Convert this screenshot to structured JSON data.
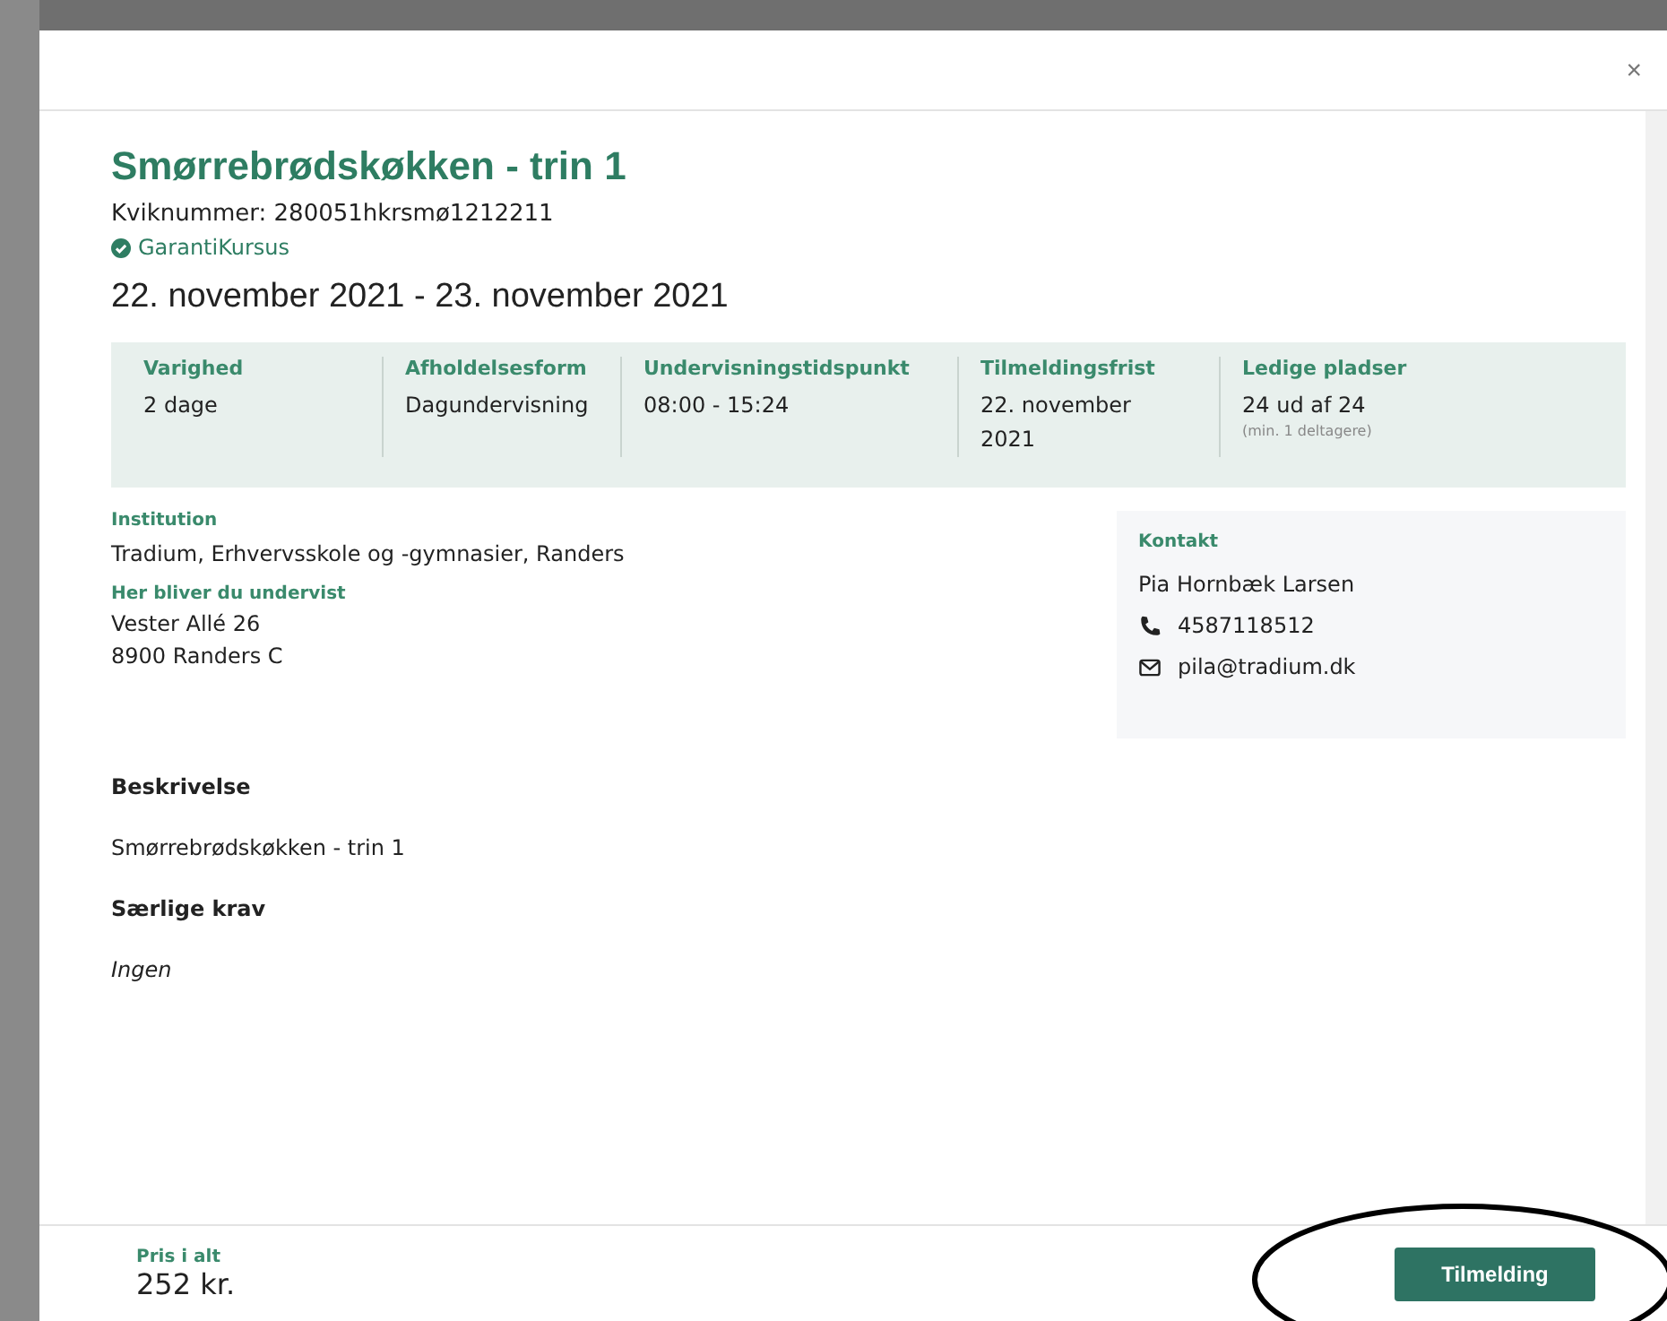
{
  "modal": {
    "close": "×"
  },
  "course": {
    "title": "Smørrebrødskøkken - trin 1",
    "kviknummer": "Kviknummer: 280051hkrsmø1212211",
    "guarantee": "GarantiKursus",
    "dates": "22. november 2021 - 23. november 2021"
  },
  "facts": [
    {
      "label": "Varighed",
      "value": "2 dage"
    },
    {
      "label": "Afholdelsesform",
      "value": "Dagundervisning"
    },
    {
      "label": "Undervisningstidspunkt",
      "value": "08:00 - 15:24"
    },
    {
      "label": "Tilmeldingsfrist",
      "value": "22. november 2021"
    },
    {
      "label": "Ledige pladser",
      "value": "24 ud af 24",
      "note": "(min. 1 deltagere)"
    }
  ],
  "institution": {
    "label": "Institution",
    "value": "Tradium, Erhvervsskole og -gymnasier, Randers"
  },
  "location": {
    "label": "Her bliver du undervist",
    "lines": [
      "Vester Allé 26",
      "8900 Randers C"
    ]
  },
  "contact": {
    "label": "Kontakt",
    "name": "Pia Hornbæk Larsen",
    "phone": "4587118512",
    "email": "pila@tradium.dk"
  },
  "sections": [
    {
      "heading": "Beskrivelse",
      "text": "Smørrebrødskøkken - trin 1",
      "italic": false
    },
    {
      "heading": "Særlige krav",
      "text": "Ingen",
      "italic": true
    }
  ],
  "footer": {
    "price_label": "Pris i alt",
    "price": "252 kr.",
    "button": "Tilmelding"
  }
}
